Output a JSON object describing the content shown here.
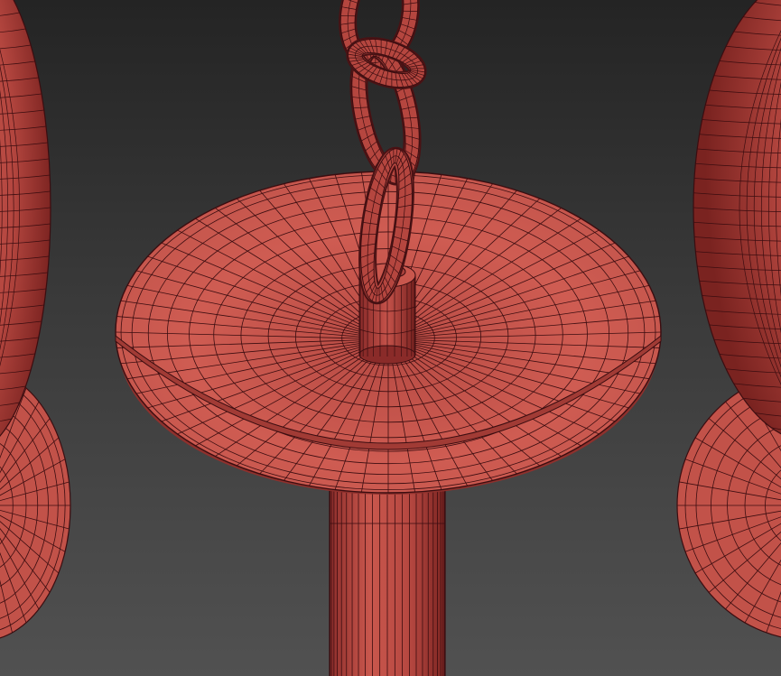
{
  "scene": {
    "background": "#3a3a3a",
    "mesh_color": "#c9574d",
    "mesh_shadow": "#8a2c2a",
    "wire_color": "#3b0d10",
    "objects": [
      "chain",
      "chain-hook",
      "saucer-plate",
      "center-post",
      "support-column",
      "left-lamp-bowl",
      "left-lamp-base",
      "right-lamp-bowl",
      "right-lamp-base"
    ]
  }
}
